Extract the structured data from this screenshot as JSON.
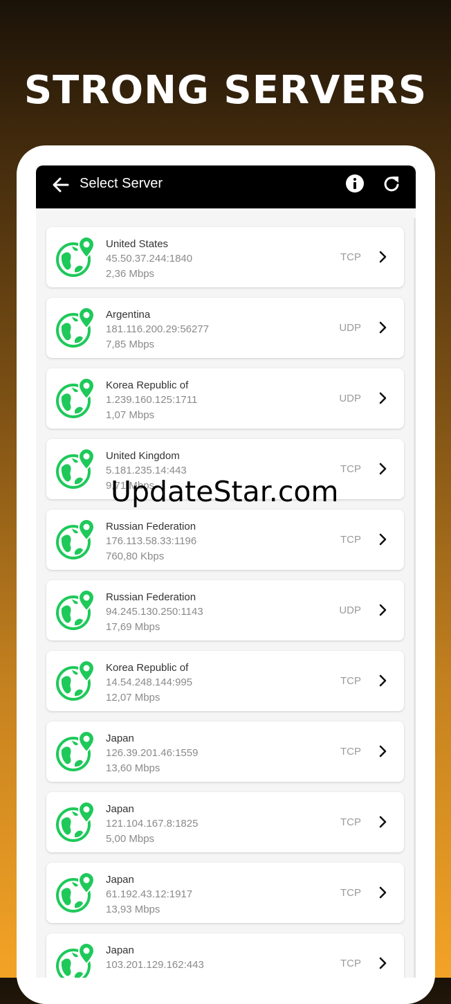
{
  "headline": "STRONG SERVERS",
  "appbar": {
    "title": "Select Server",
    "back_icon": "arrow-left-icon",
    "info_icon": "info-icon",
    "refresh_icon": "refresh-icon"
  },
  "colors": {
    "accent_green": "#1ec95a",
    "appbar_bg": "#000000",
    "gradient_top": "#1a1208",
    "gradient_bottom": "#f3a326"
  },
  "servers": [
    {
      "country": "United States",
      "address": "45.50.37.244:1840",
      "speed": "2,36 Mbps",
      "protocol": "TCP"
    },
    {
      "country": "Argentina",
      "address": "181.116.200.29:56277",
      "speed": "7,85 Mbps",
      "protocol": "UDP"
    },
    {
      "country": "Korea Republic of",
      "address": "1.239.160.125:1711",
      "speed": "1,07 Mbps",
      "protocol": "UDP"
    },
    {
      "country": "United Kingdom",
      "address": "5.181.235.14:443",
      "speed": "9,71 Mbps",
      "protocol": "TCP"
    },
    {
      "country": "Russian Federation",
      "address": "176.113.58.33:1196",
      "speed": "760,80 Kbps",
      "protocol": "TCP"
    },
    {
      "country": "Russian Federation",
      "address": "94.245.130.250:1143",
      "speed": "17,69 Mbps",
      "protocol": "UDP"
    },
    {
      "country": "Korea Republic of",
      "address": "14.54.248.144:995",
      "speed": "12,07 Mbps",
      "protocol": "TCP"
    },
    {
      "country": "Japan",
      "address": "126.39.201.46:1559",
      "speed": "13,60 Mbps",
      "protocol": "TCP"
    },
    {
      "country": "Japan",
      "address": "121.104.167.8:1825",
      "speed": "5,00 Mbps",
      "protocol": "TCP"
    },
    {
      "country": "Japan",
      "address": "61.192.43.12:1917",
      "speed": "13,93 Mbps",
      "protocol": "TCP"
    },
    {
      "country": "Japan",
      "address": "103.201.129.162:443",
      "speed": "",
      "protocol": "TCP"
    }
  ],
  "watermark": "UpdateStar.com"
}
